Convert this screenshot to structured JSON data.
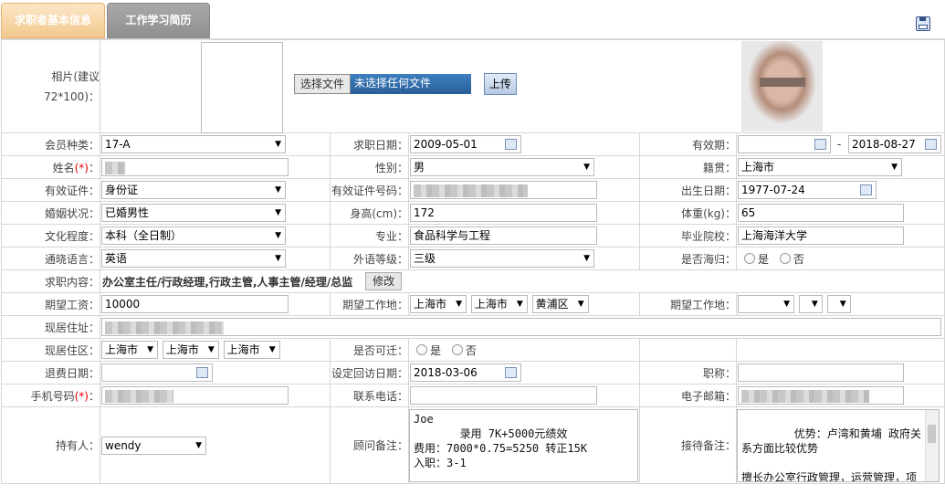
{
  "tabs": [
    "求职者基本信息",
    "工作学习简历"
  ],
  "save_icon": "save-icon",
  "photo": {
    "label": "相片(建议72*100)：",
    "choose_btn": "选择文件",
    "file_name": "未选择任何文件",
    "upload_btn": "上传"
  },
  "labels": {
    "member_type": "会员种类：",
    "apply_date": "求职日期：",
    "valid_period": "有效期：",
    "name": "姓名",
    "gender": "性别：",
    "native": "籍贯：",
    "id_type": "有效证件：",
    "id_no": "有效证件号码：",
    "birth": "出生日期：",
    "marital": "婚姻状况：",
    "height": "身高(cm)：",
    "weight": "体重(kg)：",
    "education": "文化程度：",
    "major": "专业：",
    "school": "毕业院校：",
    "language": "通晓语言：",
    "lang_level": "外语等级：",
    "overseas": "是否海归：",
    "job_content": "求职内容：",
    "salary": "期望工资：",
    "work_place": "期望工作地：",
    "work_place2": "期望工作地：",
    "address": "现居住址：",
    "district": "现居住区：",
    "relocate": "是否可迁：",
    "refund_date": "退费日期：",
    "visit_date": "设定回访日期：",
    "title": "职称：",
    "mobile": "手机号码",
    "phone": "联系电话：",
    "email": "电子邮箱：",
    "holder": "持有人：",
    "consultant_note": "顾问备注：",
    "reception_note": "接待备注："
  },
  "req_mark": "(*)",
  "colon": "：",
  "values": {
    "member_type": "17-A",
    "apply_date": "2009-05-01",
    "valid_from": "",
    "dash": "-",
    "valid_to": "2018-08-27",
    "gender": "男",
    "native": "上海市",
    "id_type": "身份证",
    "birth": "1977-07-24",
    "marital": "已婚男性",
    "height": "172",
    "weight": "65",
    "education": "本科（全日制）",
    "major": "食品科学与工程",
    "school": "上海海洋大学",
    "language": "英语",
    "lang_level": "三级",
    "yes": "是",
    "no": "否",
    "job_content": "办公室主任/行政经理,行政主管,人事主管/经理/总监",
    "modify_btn": "修改",
    "salary": "10000",
    "work_province": "上海市",
    "work_city": "上海市",
    "work_district": "黄浦区",
    "district_province": "上海市",
    "district_city": "上海市",
    "district_area": "上海市",
    "refund_date": "",
    "visit_date": "2018-03-06",
    "title": "",
    "phone": "",
    "holder": "wendy",
    "consultant_note": "Joe\n       录用 7K+5000元绩效\n费用：7000*0.75=5250 转正15K\n入职：3-1",
    "reception_note": "优势：卢湾和黄埔 政府关系方面比较优势\n\n擅长办公室行政管理，运营管理，项目管理"
  }
}
